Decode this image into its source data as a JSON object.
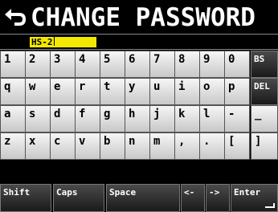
{
  "header": {
    "title": "CHANGE PASSWORD",
    "back_icon": "return-arrow-icon"
  },
  "input": {
    "value": "HS-2"
  },
  "keyboard": {
    "row1": [
      "1",
      "2",
      "3",
      "4",
      "5",
      "6",
      "7",
      "8",
      "9",
      "0",
      "BS"
    ],
    "row2": [
      "q",
      "w",
      "e",
      "r",
      "t",
      "y",
      "u",
      "i",
      "o",
      "p",
      "DEL"
    ],
    "row3": [
      "a",
      "s",
      "d",
      "f",
      "g",
      "h",
      "j",
      "k",
      "l",
      "-",
      "_"
    ],
    "row4": [
      "z",
      "x",
      "c",
      "v",
      "b",
      "n",
      "m",
      ",",
      ".",
      "[",
      "]"
    ],
    "bottom": {
      "shift": "Shift",
      "caps": "Caps",
      "space": "Space",
      "left": "<-",
      "right": "->",
      "enter": "Enter"
    }
  },
  "colors": {
    "background": "#000000",
    "input_highlight": "#f5e800",
    "key_light": "#e6e6e6",
    "key_dark": "#2a2a2a"
  }
}
